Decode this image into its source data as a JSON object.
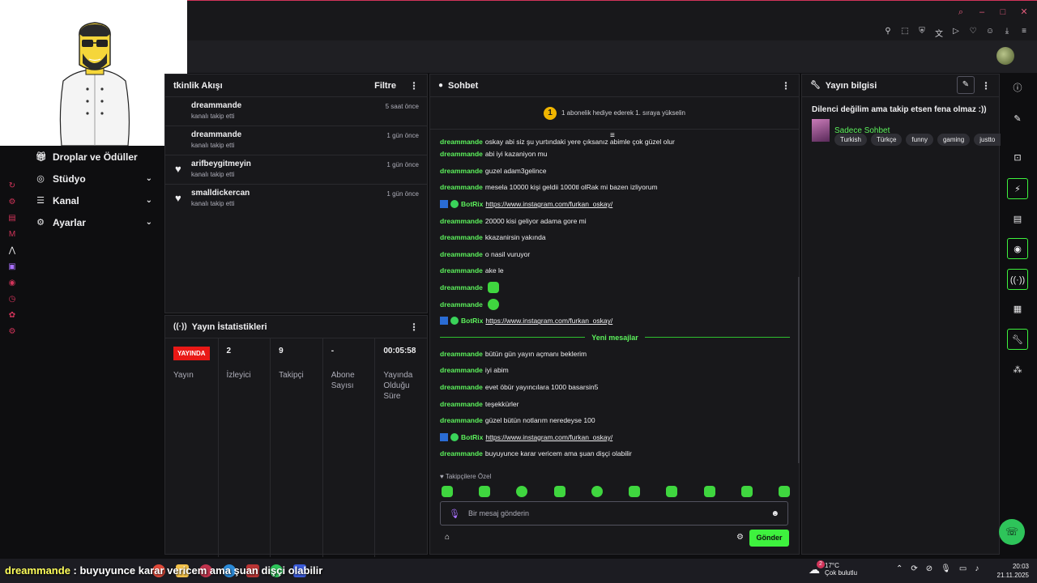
{
  "window": {
    "title_icons": [
      "search-icon",
      "minimize-icon",
      "maximize-icon",
      "close-icon"
    ],
    "tool_icons": [
      "pin-icon",
      "crop-icon",
      "shield-icon",
      "translate-icon",
      "play-icon",
      "heart-icon",
      "user-icon",
      "download-icon",
      "menu-icon"
    ]
  },
  "sidebar": {
    "items": [
      {
        "label": "Droplar ve Ödüller",
        "icon": "gift-icon"
      },
      {
        "label": "Stüdyo",
        "icon": "video-icon"
      },
      {
        "label": "Kanal",
        "icon": "list-icon"
      },
      {
        "label": "Ayarlar",
        "icon": "gear-icon"
      }
    ]
  },
  "activity": {
    "title": "tkinlik Akışı",
    "filter_label": "Filtre",
    "items": [
      {
        "name": "dreammande",
        "sub": "kanalı takip etti",
        "time": "5 saat önce"
      },
      {
        "name": "dreammande",
        "sub": "kanalı takip etti",
        "time": "1 gün önce"
      },
      {
        "name": "arifbeygitmeyin",
        "sub": "kanalı takip etti",
        "time": "1 gün önce"
      },
      {
        "name": "smalldickercan",
        "sub": "kanalı takip etti",
        "time": "1 gün önce"
      }
    ]
  },
  "stats": {
    "title": "Yayın İstatistikleri",
    "live_badge": "YAYINDA",
    "live_label": "Yayın",
    "columns": [
      {
        "value": "2",
        "label": "İzleyici"
      },
      {
        "value": "9",
        "label": "Takipçi"
      },
      {
        "value": "-",
        "label": "Abone Sayısı"
      },
      {
        "value": "00:05:58",
        "label": "Yayında Olduğu Süre"
      }
    ]
  },
  "chat": {
    "title": "Sohbet",
    "banner_rank": "1",
    "banner_text": "1 abonelik hediye ederek 1. sıraya yükselin",
    "messages": [
      {
        "user": "dreammande",
        "text": "oskay abi siz şu yurtındaki yere çıksanız abimle çok güzel olur"
      },
      {
        "user": "dreammande",
        "text": "abi iyi kazaniyon mu"
      },
      {
        "user": "dreammande",
        "text": "guzel adam3gelince"
      },
      {
        "user": "dreammande",
        "text": "mesela 10000 kişi geldii 1000tl olRak mi bazen izliyorum"
      },
      {
        "user": "BotRix",
        "text": "https://www.instagram.com/furkan_oskay/",
        "bot": true
      },
      {
        "user": "dreammande",
        "text": "20000 kisi geliyor adama gore mi"
      },
      {
        "user": "dreammande",
        "text": "kkazanirsin yakında"
      },
      {
        "user": "dreammande",
        "text": "o nasil vuruyor"
      },
      {
        "user": "dreammande",
        "text": "ake le"
      },
      {
        "user": "dreammande",
        "text": "",
        "emote": true
      },
      {
        "user": "dreammande",
        "text": "",
        "emote": true
      },
      {
        "user": "BotRix",
        "text": "https://www.instagram.com/furkan_oskay/",
        "bot": true
      }
    ],
    "new_messages_label": "Yeni mesajlar",
    "new_messages": [
      {
        "user": "dreammande",
        "text": "bütün gün yayın açmanı beklerim"
      },
      {
        "user": "dreammande",
        "text": "iyi abim"
      },
      {
        "user": "dreammande",
        "text": "evet öbür yayıncılara 1000 basarsin5"
      },
      {
        "user": "dreammande",
        "text": "teşekkürler"
      },
      {
        "user": "dreammande",
        "text": "güzel bütün notlarım neredeyse 100"
      },
      {
        "user": "BotRix",
        "text": "https://www.instagram.com/furkan_oskay/",
        "bot": true
      },
      {
        "user": "dreammande",
        "text": "buyuyunce karar vericem ama şuan dişçi olabilir"
      }
    ],
    "follower_only": "♥ Takipçilere Özel",
    "input_placeholder": "Bir mesaj gönderin",
    "send_label": "Gönder"
  },
  "stream_info": {
    "title": "Yayın bilgisi",
    "stream_title": "Dilenci değilim ama takip etsen fena olmaz :))",
    "category": "Sadece Sohbet",
    "tags": [
      "Turkish",
      "Türkçe",
      "funny",
      "gaming",
      "justto"
    ]
  },
  "overlay": {
    "user": "dreammande",
    "separator": " : ",
    "text": "buyuyunce karar vericem ama şuan dişçi olabilir"
  },
  "taskbar": {
    "weather_temp": "17°C",
    "weather_desc": "Çok bulutlu",
    "weather_badge": "2",
    "time": "20:03",
    "date": "21.11.2025"
  },
  "colors": {
    "accent": "#3ef23e",
    "username": "#5cf25c",
    "live": "#e91916",
    "titlebar_accent": "#d2345a"
  }
}
